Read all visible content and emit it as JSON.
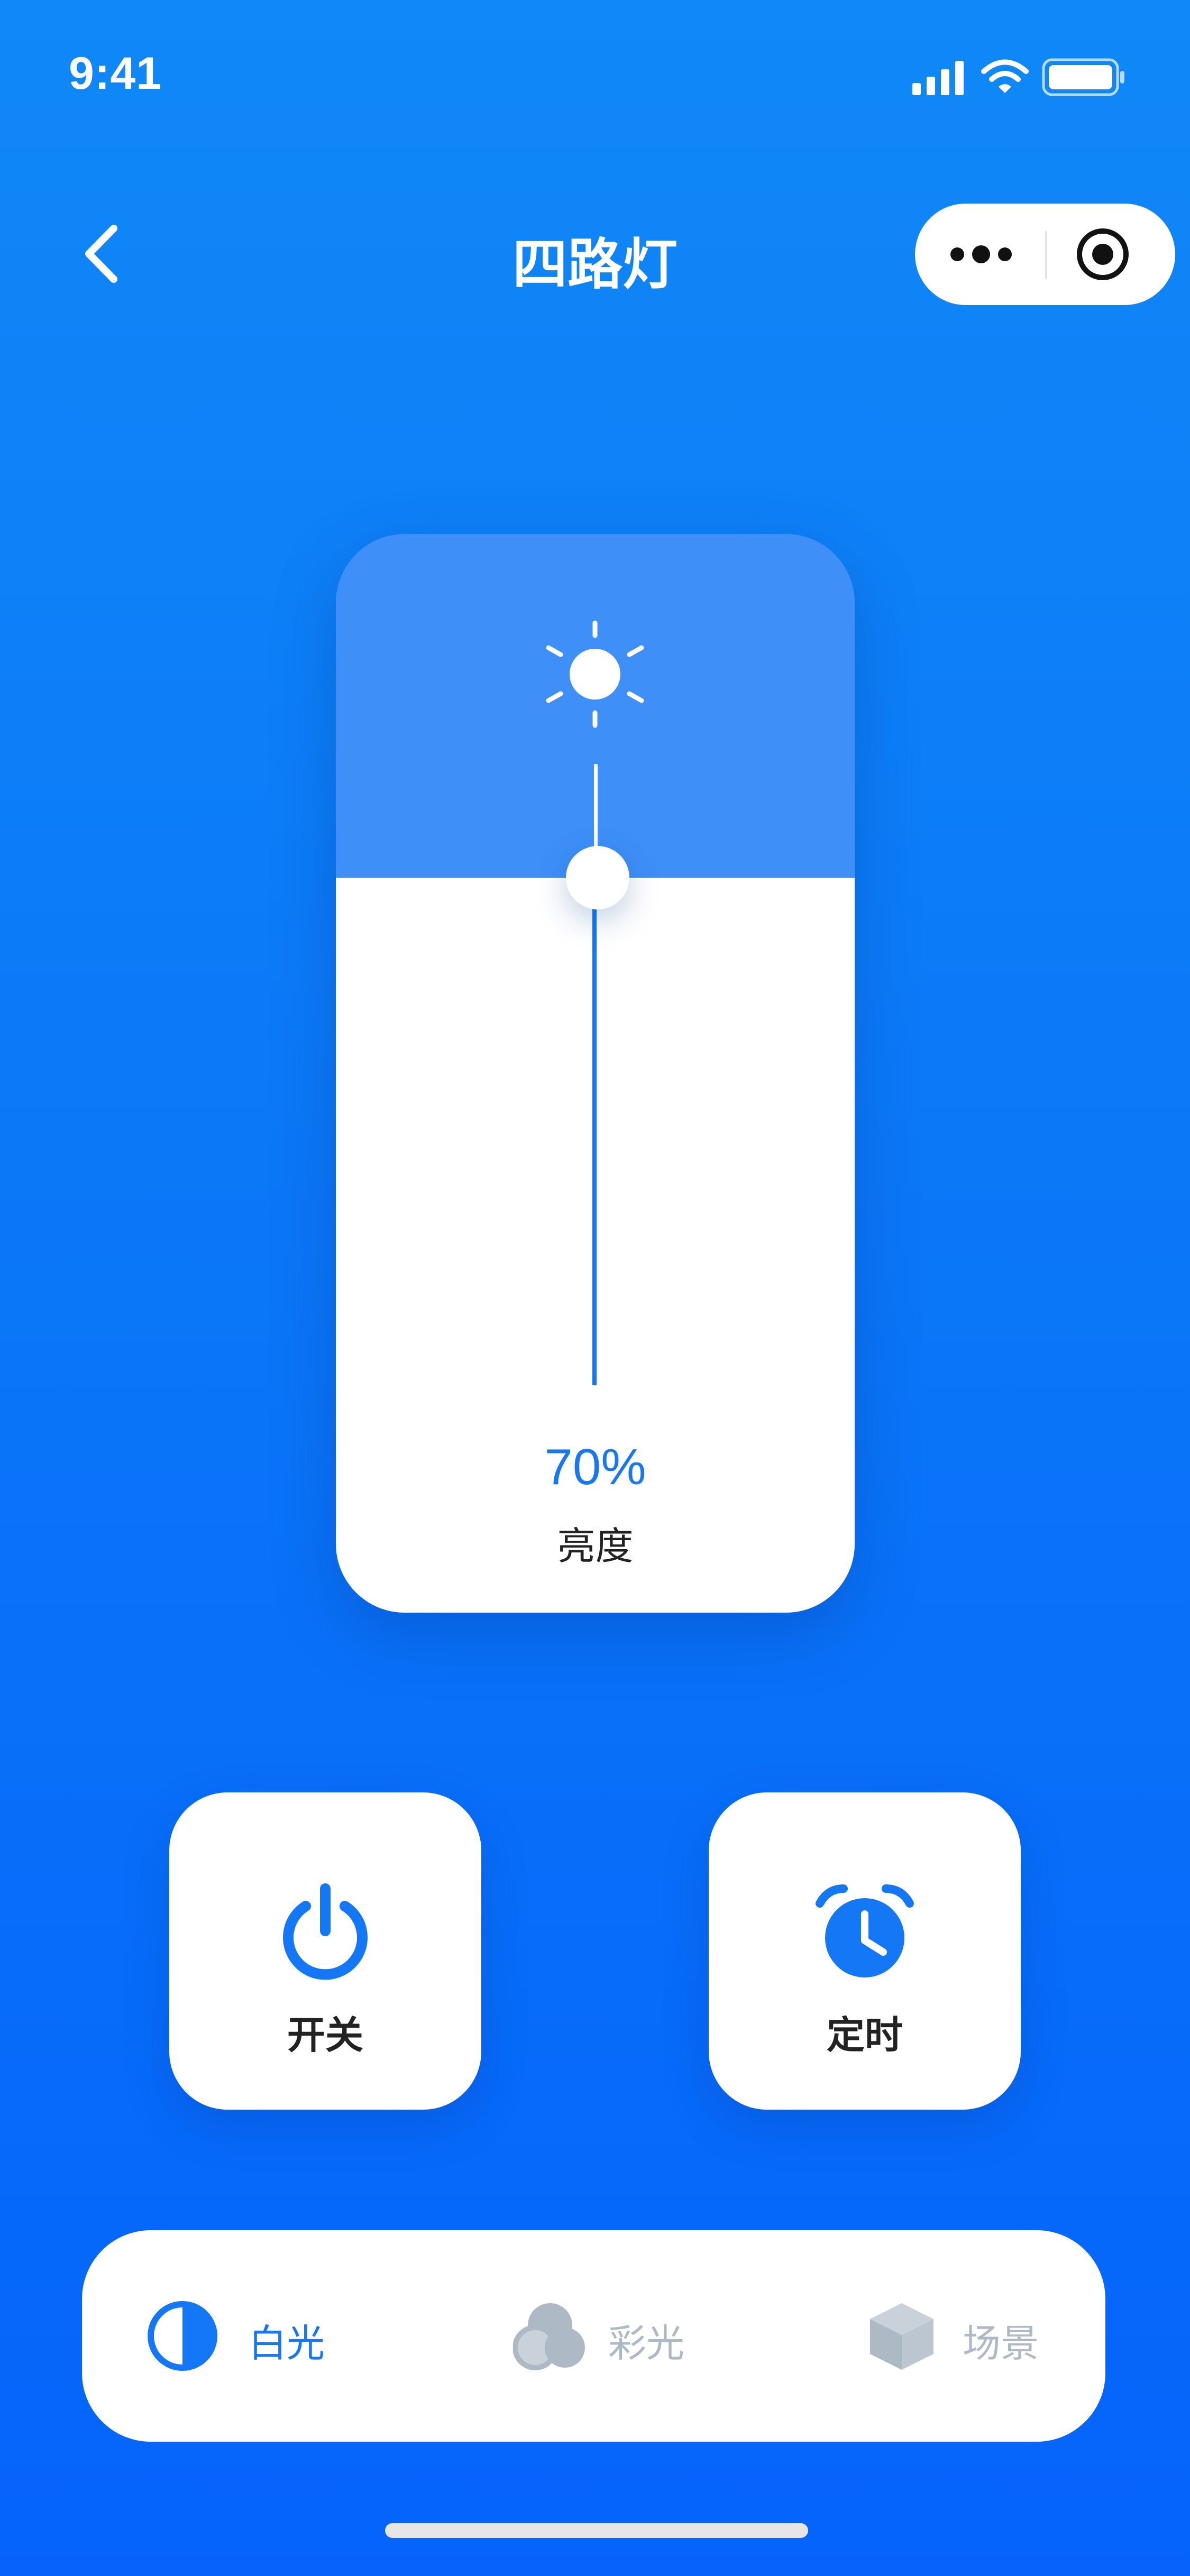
{
  "status_bar": {
    "time": "9:41"
  },
  "nav": {
    "title": "四路灯"
  },
  "brightness": {
    "value_text": "70%",
    "label": "亮度",
    "level": 0.7
  },
  "actions": [
    {
      "label": "开关",
      "icon": "power-icon"
    },
    {
      "label": "定时",
      "icon": "alarm-clock-icon"
    }
  ],
  "tabs": [
    {
      "label": "白光",
      "icon": "half-circle-icon",
      "active": true
    },
    {
      "label": "彩光",
      "icon": "color-circles-icon",
      "active": false
    },
    {
      "label": "场景",
      "icon": "cube-icon",
      "active": false
    }
  ],
  "colors": {
    "accent": "#1877F2",
    "background_top": "#1088F7",
    "background_bottom": "#0563FB",
    "inactive": "#AEB9C6"
  }
}
